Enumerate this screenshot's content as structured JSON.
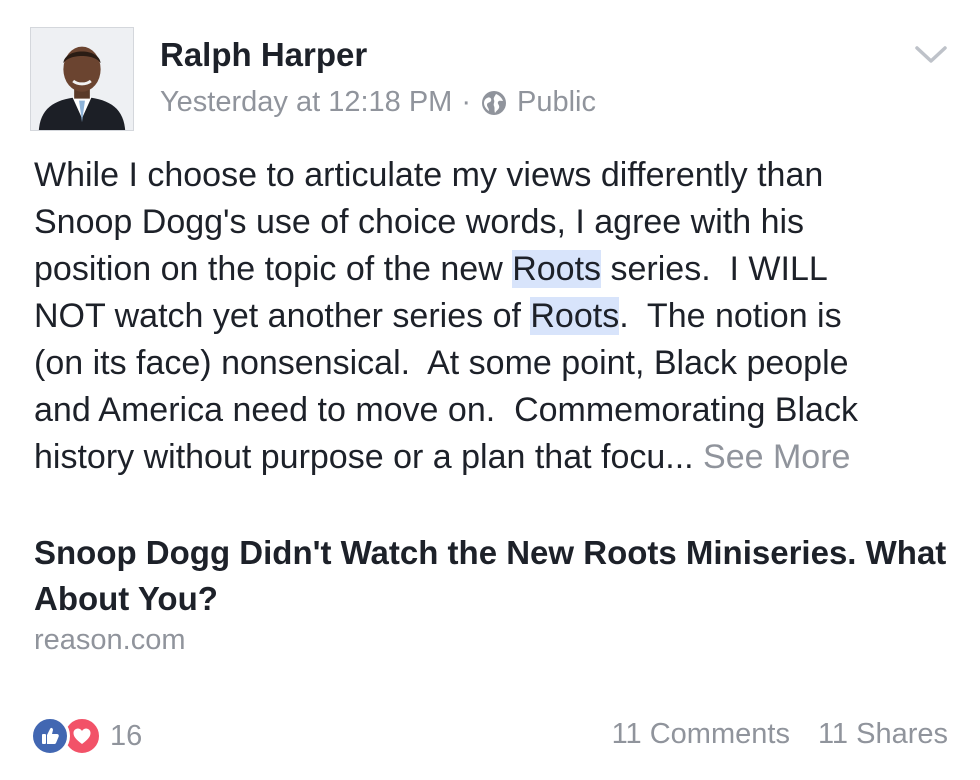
{
  "post": {
    "author": "Ralph Harper",
    "timestamp": "Yesterday at 12:18 PM",
    "separator": "·",
    "privacy": "Public",
    "privacy_icon": "globe-icon",
    "menu_icon": "chevron-down-icon",
    "text_segments": [
      "While I choose to articulate my views differently than Snoop Dogg's use of choice words, I agree with his position on the topic of the new ",
      "Roots",
      " series.  I WILL NOT watch yet another series of ",
      "Roots",
      ".  The notion is (on its face) nonsensical.  At some point, Black people and America need to move on.  Commemorating Black history without purpose or a plan that focu... "
    ],
    "see_more": "See More"
  },
  "link": {
    "title": "Snoop Dogg Didn't Watch the New Roots Miniseries. What About You?",
    "domain": "reason.com"
  },
  "footer": {
    "reaction_icons": [
      "like-icon",
      "love-icon"
    ],
    "reactions_count": "16",
    "comments": "11 Comments",
    "shares": "11 Shares"
  },
  "colors": {
    "text": "#1d2129",
    "secondary": "#90949c",
    "highlight": "#d8e4fb",
    "like": "#4267b2",
    "love": "#f25268"
  }
}
